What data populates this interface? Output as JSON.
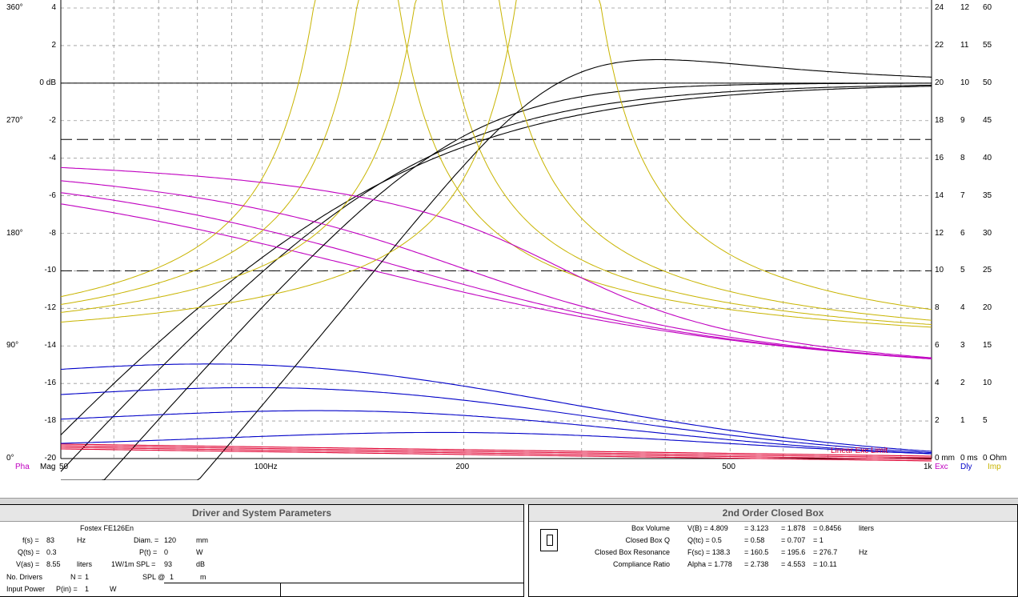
{
  "graph": {
    "left_axis_mag": [
      "4",
      "2",
      "0 dB",
      "-2",
      "-4",
      "-6",
      "-8",
      "-10",
      "-12",
      "-14",
      "-16",
      "-18",
      "-20"
    ],
    "left_axis_phase": [
      "360°",
      "270°",
      "180°",
      "90°",
      "0°"
    ],
    "right_axis_exc": [
      "24",
      "22",
      "20",
      "18",
      "16",
      "14",
      "12",
      "10",
      "8",
      "6",
      "4",
      "2",
      "0 mm"
    ],
    "right_axis_dly": [
      "12",
      "11",
      "10",
      "9",
      "8",
      "7",
      "6",
      "5",
      "4",
      "3",
      "2",
      "1",
      "0 ms"
    ],
    "right_axis_imp": [
      "60",
      "55",
      "50",
      "45",
      "40",
      "35",
      "30",
      "25",
      "20",
      "15",
      "10",
      "5",
      "0 Ohm"
    ],
    "x_ticks": [
      "50",
      "100Hz",
      "200",
      "500",
      "1k"
    ],
    "left_legend_pha": "Pha",
    "left_legend_mag": "Mag",
    "right_legend_exc": "Exc",
    "right_legend_dly": "Dly",
    "right_legend_imp": "Imp",
    "linear_exc_limit": "Linear Exc Limit",
    "colors": {
      "mag": "#000000",
      "phase": "#c000c0",
      "delay": "#0000c8",
      "exc": "#e00030",
      "imp": "#c8b400",
      "pha_label": "#c000c0",
      "dly_label": "#0000c8",
      "imp_label": "#c8b400"
    }
  },
  "driver_panel": {
    "title": "Driver and System Parameters",
    "driver_name": "Fostex  FE126En",
    "fs_label": "f(s) =",
    "fs_value": "83",
    "fs_unit": "Hz",
    "qts_label": "Q(ts) =",
    "qts_value": "0.3",
    "vas_label": "V(as) =",
    "vas_value": "8.55",
    "vas_unit": "liters",
    "diam_label": "Diam. =",
    "diam_value": "120",
    "diam_unit": "mm",
    "pt_label": "P(t) =",
    "pt_value": "0",
    "pt_unit": "W",
    "spl_label": "1W/1m SPL =",
    "spl_value": "93",
    "spl_unit": "dB",
    "drivers_label": "No. Drivers",
    "drivers_eq": "N =",
    "drivers_value": "1",
    "splat_label": "SPL @",
    "splat_value": "1",
    "splat_unit": "m",
    "input_label": "Input Power",
    "input_eq": "P(in) =",
    "input_value": "1",
    "input_unit": "W"
  },
  "box_panel": {
    "title": "2nd Order Closed Box",
    "rows": [
      {
        "label": "Box Volume",
        "sym": "V(B) = 4.809",
        "v2": "= 3.123",
        "v3": "= 1.878",
        "v4": "= 0.8456",
        "unit": "liters"
      },
      {
        "label": "Closed Box Q",
        "sym": "Q(tc) = 0.5",
        "v2": "= 0.58",
        "v3": "= 0.707",
        "v4": "= 1",
        "unit": ""
      },
      {
        "label": "Closed Box Resonance",
        "sym": "F(sc) = 138.3",
        "v2": "= 160.5",
        "v3": "= 195.6",
        "v4": "= 276.7",
        "unit": "Hz"
      },
      {
        "label": "Compliance Ratio",
        "sym": "Alpha = 1.778",
        "v2": "= 2.738",
        "v3": "= 4.553",
        "v4": "= 10.11",
        "unit": ""
      }
    ]
  }
}
